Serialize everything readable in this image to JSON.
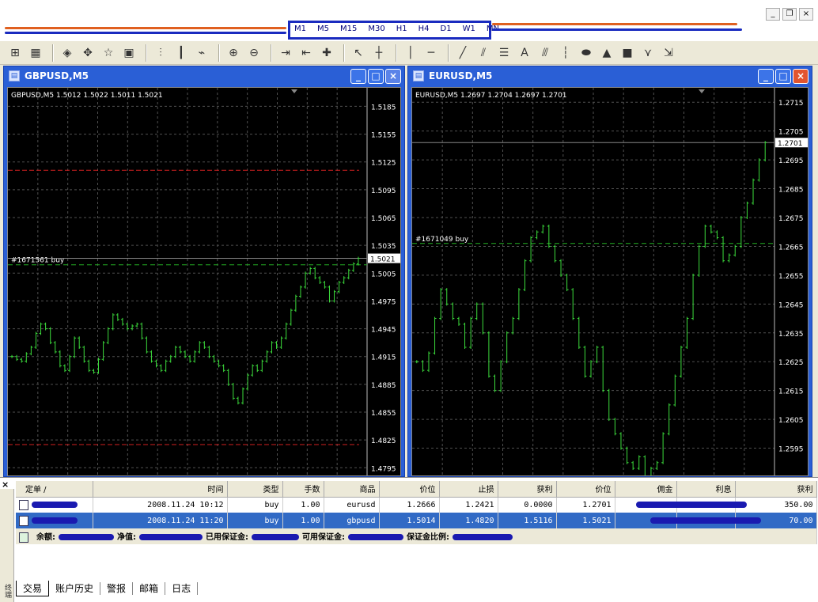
{
  "menubar": {
    "timeframes": [
      "M1",
      "M5",
      "M15",
      "M30",
      "H1",
      "H4",
      "D1",
      "W1",
      "MN"
    ],
    "colors": {
      "redact_blue": "#1a2bbf",
      "redact_orange": "#e06020"
    }
  },
  "toolbar": {
    "icons": [
      "new-chart-icon",
      "profiles-icon",
      "market-watch-icon",
      "navigator-icon",
      "favorites-icon",
      "terminal-icon",
      "bar-chart-icon",
      "candlestick-icon",
      "line-chart-icon",
      "zoom-in-icon",
      "zoom-out-icon",
      "autoscroll-icon",
      "chart-shift-icon",
      "indicators-icon",
      "cursor-icon",
      "crosshair-icon",
      "vertical-line-icon",
      "horizontal-line-icon",
      "trendline-icon",
      "equidistant-channel-icon",
      "fibonacci-icon",
      "text-icon",
      "pitchfork-icon",
      "gann-icon",
      "ellipse-icon",
      "triangle-icon",
      "rectangle-icon",
      "fibo-fan-icon",
      "arrows-icon"
    ]
  },
  "charts": [
    {
      "window_title": "GBPUSD,M5",
      "header": "GBPUSD,M5  1.5012 1.5022 1.5011 1.5021",
      "order_label": "#1671561 buy",
      "price_label": "1.5021",
      "y_ticks": [
        "1.5185",
        "1.5155",
        "1.5125",
        "1.5095",
        "1.5065",
        "1.5035",
        "1.5005",
        "1.4975",
        "1.4945",
        "1.4915",
        "1.4885",
        "1.4855",
        "1.4825",
        "1.4795"
      ]
    },
    {
      "window_title": "EURUSD,M5",
      "header": "EURUSD,M5  1.2697 1.2704 1.2697 1.2701",
      "order_label": "#1671049 buy",
      "price_label": "1.2701",
      "y_ticks": [
        "1.2715",
        "1.2705",
        "1.2695",
        "1.2685",
        "1.2675",
        "1.2665",
        "1.2655",
        "1.2645",
        "1.2635",
        "1.2625",
        "1.2615",
        "1.2605",
        "1.2595"
      ]
    }
  ],
  "chart_data": [
    {
      "type": "bar",
      "symbol": "GBPUSD",
      "timeframe": "M5",
      "ylim": [
        1.4785,
        1.5205
      ],
      "order_level": 1.5014,
      "stop_level": 1.482,
      "take_level": 1.5116,
      "close_series": [
        1.4915,
        1.4912,
        1.491,
        1.4918,
        1.4925,
        1.494,
        1.495,
        1.4945,
        1.493,
        1.492,
        1.4905,
        1.49,
        1.4915,
        1.4935,
        1.4925,
        1.491,
        1.49,
        1.4898,
        1.4912,
        1.493,
        1.4945,
        1.496,
        1.4955,
        1.495,
        1.4945,
        1.4948,
        1.495,
        1.4935,
        1.492,
        1.491,
        1.4905,
        1.49,
        1.491,
        1.4915,
        1.4925,
        1.492,
        1.4915,
        1.491,
        1.492,
        1.493,
        1.4925,
        1.4915,
        1.491,
        1.4905,
        1.49,
        1.4885,
        1.487,
        1.4865,
        1.488,
        1.4895,
        1.4905,
        1.49,
        1.491,
        1.492,
        1.493,
        1.4925,
        1.4935,
        1.495,
        1.4965,
        1.498,
        1.499,
        1.5005,
        1.501,
        1.5,
        1.4995,
        1.499,
        1.4975,
        1.4985,
        1.4995,
        1.5,
        1.5008,
        1.5015,
        1.5021
      ]
    },
    {
      "type": "bar",
      "symbol": "EURUSD",
      "timeframe": "M5",
      "ylim": [
        1.2585,
        1.272
      ],
      "order_level": 1.2666,
      "current_level": 1.2701,
      "close_series": [
        1.2625,
        1.2622,
        1.2628,
        1.264,
        1.265,
        1.2645,
        1.264,
        1.2638,
        1.263,
        1.264,
        1.2645,
        1.2635,
        1.262,
        1.2615,
        1.2625,
        1.2635,
        1.264,
        1.265,
        1.266,
        1.2668,
        1.267,
        1.2672,
        1.2665,
        1.266,
        1.2655,
        1.265,
        1.264,
        1.263,
        1.262,
        1.2625,
        1.263,
        1.2615,
        1.2605,
        1.26,
        1.2595,
        1.259,
        1.2588,
        1.2592,
        1.2585,
        1.2588,
        1.259,
        1.26,
        1.261,
        1.262,
        1.263,
        1.264,
        1.2655,
        1.2665,
        1.2672,
        1.267,
        1.2668,
        1.266,
        1.2662,
        1.2665,
        1.2675,
        1.268,
        1.2688,
        1.2695,
        1.2701
      ]
    }
  ],
  "terminal": {
    "close_label": "×",
    "side_label": "终端",
    "columns": [
      "定单 /",
      "时间",
      "类型",
      "手数",
      "商品",
      "价位",
      "止损",
      "获利",
      "价位",
      "佣金",
      "利息",
      "获利"
    ],
    "rows": [
      {
        "time": "2008.11.24 10:12",
        "type": "buy",
        "lots": "1.00",
        "symbol": "eurusd",
        "price": "1.2666",
        "sl": "1.2421",
        "tp": "0.0000",
        "current": "1.2701",
        "profit": "350.00"
      },
      {
        "time": "2008.11.24 11:20",
        "type": "buy",
        "lots": "1.00",
        "symbol": "gbpusd",
        "price": "1.5014",
        "sl": "1.4820",
        "tp": "1.5116",
        "current": "1.5021",
        "profit": "70.00"
      }
    ],
    "balance_labels": {
      "balance": "余额:",
      "equity": "净值:",
      "margin": "已用保证金:",
      "free_margin": "可用保证金:",
      "margin_level": "保证金比例:"
    },
    "tabs": [
      "交易",
      "账户历史",
      "警报",
      "邮箱",
      "日志"
    ]
  }
}
